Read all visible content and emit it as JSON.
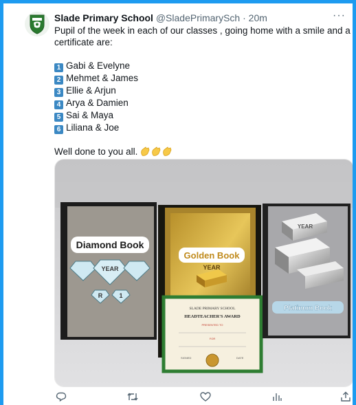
{
  "tweet": {
    "author_name": "Slade Primary School",
    "handle": "@SladePrimarySch",
    "separator": "·",
    "time": "20m",
    "more": "···",
    "intro": "Pupil of the week in each of our classes , going home with a smile and a certificate are:",
    "intro_line1": "Pupil of the week in each of our classes , going home with a smile and a",
    "intro_line2": "certificate are:",
    "winners": [
      {
        "num": "1",
        "names": "Gabi & Evelyne"
      },
      {
        "num": "2",
        "names": "Mehmet & James"
      },
      {
        "num": "3",
        "names": "Ellie & Arjun"
      },
      {
        "num": "4",
        "names": "Arya & Damien"
      },
      {
        "num": "5",
        "names": "Sai & Maya"
      },
      {
        "num": "6",
        "names": "Liliana & Joe"
      }
    ],
    "closing": "Well done to you all.",
    "closing_emoji": "clapping-hands x3"
  },
  "photo": {
    "book_left_title": "Diamond Book",
    "book_left_year": "YEAR",
    "book_left_r": "R",
    "book_left_1": "1",
    "book_mid_title": "Golden Book",
    "book_mid_year": "YEAR",
    "book_right_year": "YEAR",
    "book_right_badge": "Platinum Book",
    "cert_school": "SLADE PRIMARY SCHOOL",
    "cert_award": "HEADTEACHER'S AWARD",
    "cert_presented": "PRESENTED TO",
    "cert_for": "FOR",
    "cert_signed": "SIGNED",
    "cert_date": "DATE"
  },
  "actions": {
    "icons": [
      "reply-icon",
      "retweet-icon",
      "like-icon",
      "views-icon",
      "share-icon"
    ]
  },
  "colors": {
    "frame": "#1d9bf0",
    "text": "#0f1419",
    "muted": "#536471",
    "badge": "#3b88c3"
  }
}
